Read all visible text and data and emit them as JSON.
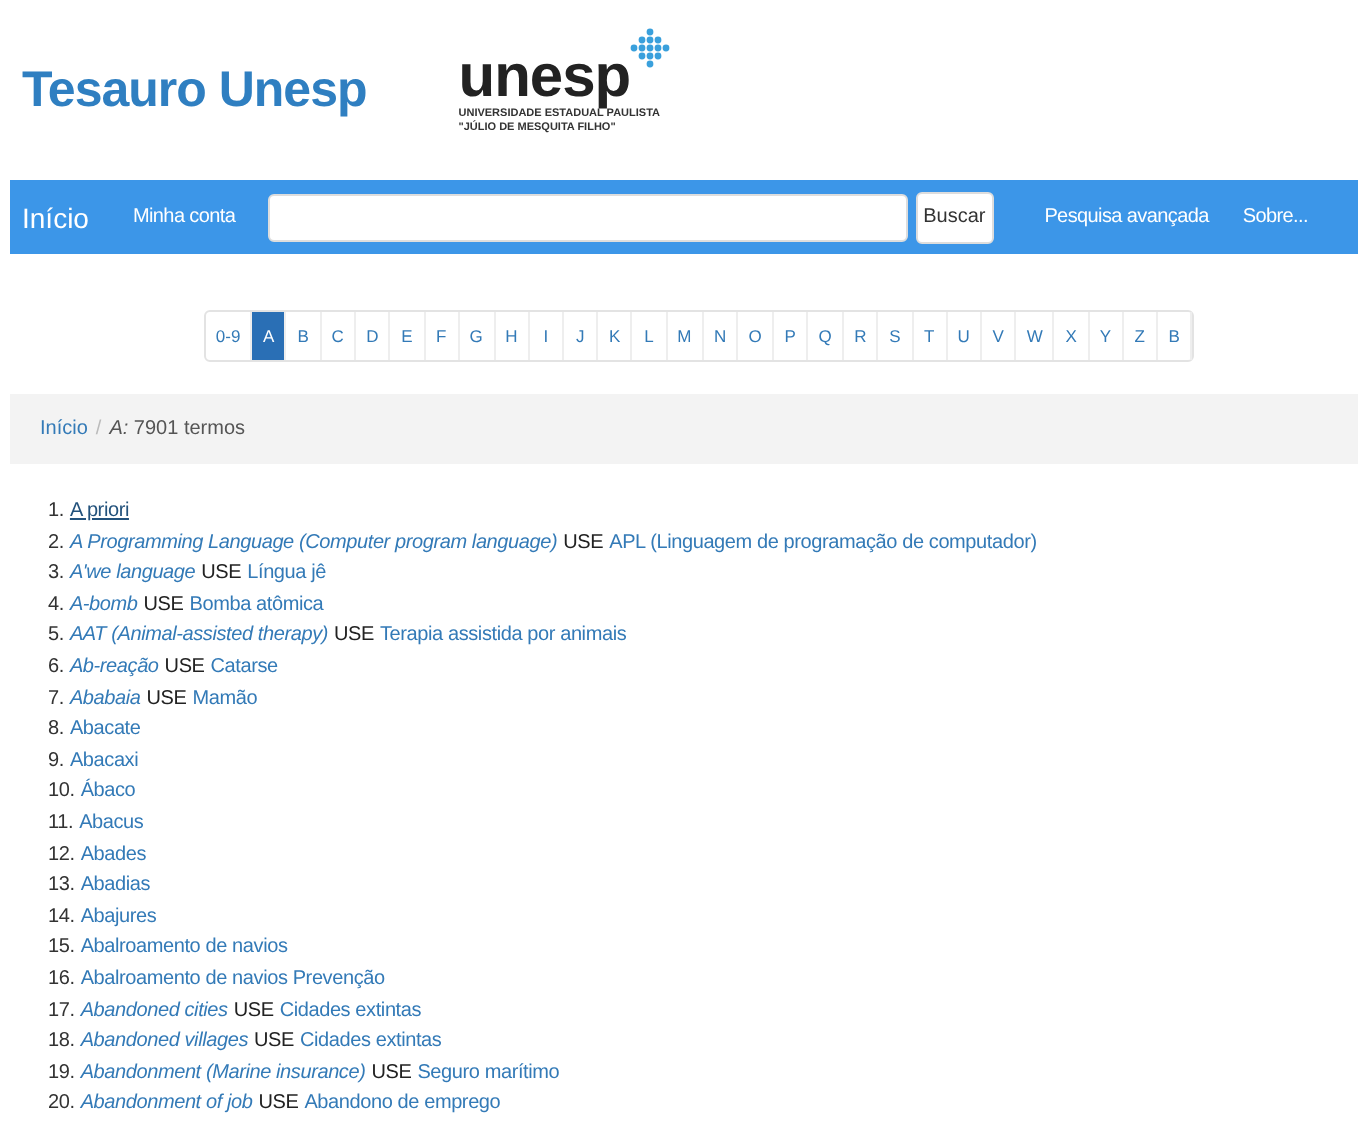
{
  "header": {
    "title": "Tesauro Unesp",
    "logo": {
      "name": "unesp",
      "line_1": "UNIVERSIDADE ESTADUAL PAULISTA",
      "line_2": "\"JÚLIO DE MESQUITA FILHO\""
    }
  },
  "navbar": {
    "brand": "Início",
    "account": "Minha conta",
    "search": {
      "button": "Buscar"
    },
    "advanced": "Pesquisa avançada",
    "about": "Sobre..."
  },
  "letters": [
    {
      "label": "0-9",
      "selected": false
    },
    {
      "label": "A",
      "selected": true
    },
    {
      "label": "B",
      "selected": false
    },
    {
      "label": "C",
      "selected": false
    },
    {
      "label": "D",
      "selected": false
    },
    {
      "label": "E",
      "selected": false
    },
    {
      "label": "F",
      "selected": false
    },
    {
      "label": "G",
      "selected": false
    },
    {
      "label": "H",
      "selected": false
    },
    {
      "label": "I",
      "selected": false
    },
    {
      "label": "J",
      "selected": false
    },
    {
      "label": "K",
      "selected": false
    },
    {
      "label": "L",
      "selected": false
    },
    {
      "label": "M",
      "selected": false
    },
    {
      "label": "N",
      "selected": false
    },
    {
      "label": "O",
      "selected": false
    },
    {
      "label": "P",
      "selected": false
    },
    {
      "label": "Q",
      "selected": false
    },
    {
      "label": "R",
      "selected": false
    },
    {
      "label": "S",
      "selected": false
    },
    {
      "label": "T",
      "selected": false
    },
    {
      "label": "U",
      "selected": false
    },
    {
      "label": "V",
      "selected": false
    },
    {
      "label": "W",
      "selected": false
    },
    {
      "label": "X",
      "selected": false
    },
    {
      "label": "Y",
      "selected": false
    },
    {
      "label": "Z",
      "selected": false
    },
    {
      "label": "B",
      "selected": false
    }
  ],
  "breadcrumb": {
    "home": "Início",
    "separator": "/",
    "current": "*A:* 7901 termos"
  },
  "terms": [
    {
      "number": "1.",
      "kind": "term",
      "term": "A priori",
      "hovered": true
    },
    {
      "number": "2.",
      "kind": "use",
      "term": "A Programming Language (Computer program language)",
      "use": "USE",
      "target": "APL (Linguagem de programação de computador)",
      "hovered": false
    },
    {
      "number": "3.",
      "kind": "use",
      "term": "A'we language",
      "use": "USE",
      "target": "Língua jê",
      "hovered": false
    },
    {
      "number": "4.",
      "kind": "use",
      "term": "A-bomb",
      "use": "USE",
      "target": "Bomba atômica",
      "hovered": false
    },
    {
      "number": "5.",
      "kind": "use",
      "term": "AAT (Animal-assisted therapy)",
      "use": "USE",
      "target": "Terapia assistida por animais",
      "hovered": false
    },
    {
      "number": "6.",
      "kind": "use",
      "term": "Ab-reação",
      "use": "USE",
      "target": "Catarse",
      "hovered": false
    },
    {
      "number": "7.",
      "kind": "use",
      "term": "Ababaia",
      "use": "USE",
      "target": "Mamão",
      "hovered": false
    },
    {
      "number": "8.",
      "kind": "term",
      "term": "Abacate",
      "hovered": false
    },
    {
      "number": "9.",
      "kind": "term",
      "term": "Abacaxi",
      "hovered": false
    },
    {
      "number": "10.",
      "kind": "term",
      "term": "Ábaco",
      "hovered": false
    },
    {
      "number": "11.",
      "kind": "term",
      "term": "Abacus",
      "hovered": false
    },
    {
      "number": "12.",
      "kind": "term",
      "term": "Abades",
      "hovered": false
    },
    {
      "number": "13.",
      "kind": "term",
      "term": "Abadias",
      "hovered": false
    },
    {
      "number": "14.",
      "kind": "term",
      "term": "Abajures",
      "hovered": false
    },
    {
      "number": "15.",
      "kind": "term",
      "term": "Abalroamento de navios",
      "hovered": false
    },
    {
      "number": "16.",
      "kind": "term",
      "term": "Abalroamento de navios Prevenção",
      "hovered": false
    },
    {
      "number": "17.",
      "kind": "use",
      "term": "Abandoned cities",
      "use": "USE",
      "target": "Cidades extintas",
      "hovered": false
    },
    {
      "number": "18.",
      "kind": "use",
      "term": "Abandoned villages",
      "use": "USE",
      "target": "Cidades extintas",
      "hovered": false
    },
    {
      "number": "19.",
      "kind": "use",
      "term": "Abandonment (Marine insurance)",
      "use": "USE",
      "target": "Seguro marítimo",
      "hovered": false
    },
    {
      "number": "20.",
      "kind": "use",
      "term": "Abandonment of job",
      "use": "USE",
      "target": "Abandono de emprego",
      "hovered": false
    }
  ]
}
